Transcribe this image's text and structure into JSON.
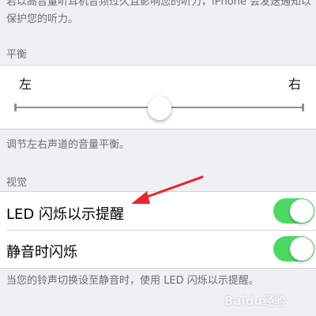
{
  "top_note": "若以高音量听耳机音频过久且影响您的听力，iPhone 会发送通知以保护您的听力。",
  "balance": {
    "section_title": "平衡",
    "left_label": "左",
    "right_label": "右",
    "value": 0.5,
    "footer": "调节左右声道的音量平衡。"
  },
  "visual": {
    "section_title": "视觉",
    "rows": [
      {
        "label": "LED 闪烁以示提醒",
        "on": true
      },
      {
        "label": "静音时闪烁",
        "on": true
      }
    ],
    "footer": "当您的铃声切换设至静音时，使用 LED 闪烁以示提醒。"
  },
  "watermark": "Baidu经验",
  "colors": {
    "toggle_on": "#4cd964",
    "annotation_arrow": "#e8262b",
    "background": "#efeff4"
  }
}
